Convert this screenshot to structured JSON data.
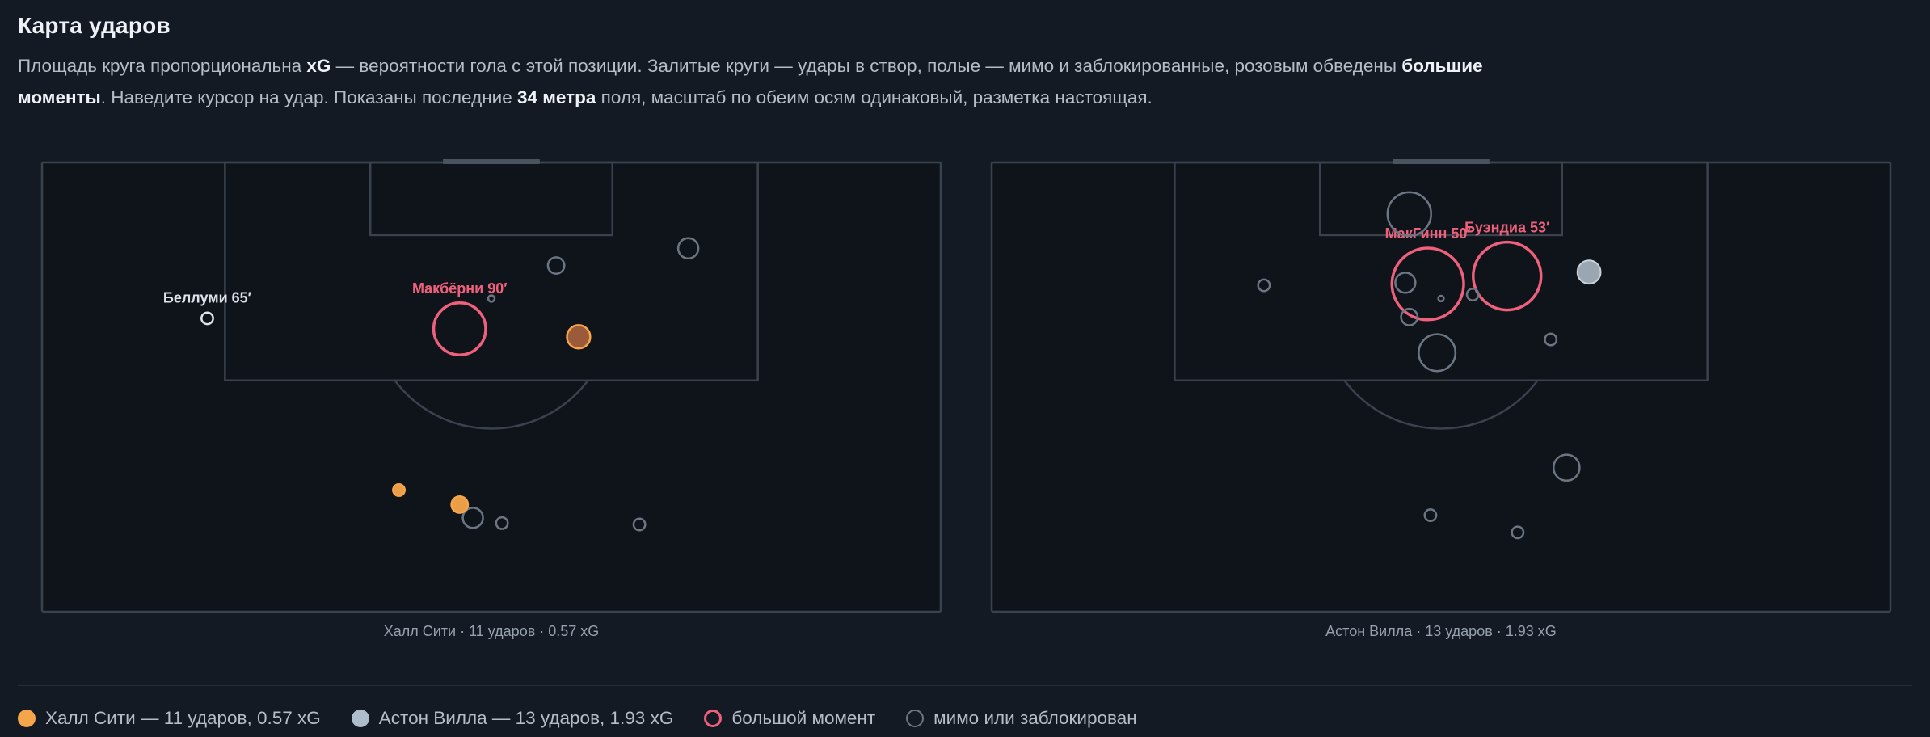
{
  "title": "Карта ударов",
  "description": {
    "p1": "Площадь круга пропорциональна ",
    "b1": "xG",
    "p2": " — вероятности гола с этой позиции. Залитые круги — удары в створ, полые — мимо и заблокированные, розовым обведены ",
    "b2": "большие моменты",
    "p3": ". Наведите курсор на удар. Показаны последние ",
    "b3": "34 метра",
    "p4": " поля, масштаб по обеим осям одинаковый, разметка настоящая."
  },
  "colors": {
    "hull": "#f5a54a",
    "villa": "#aebccb",
    "big_chance": "#ee607b",
    "miss": "#6c7682",
    "lines": "#3a424d",
    "pitch": "#0f141b"
  },
  "legend": {
    "hull": "Халл Сити — 11 ударов, 0.57 xG",
    "villa": "Астон Вилла — 13 ударов, 1.93 xG",
    "big": "большой момент",
    "miss": "мимо или заблокирован"
  },
  "chart_data": [
    {
      "type": "scatter",
      "team": "Халл Сити",
      "caption": "Халл Сити · 11 ударов · 0.57 xG",
      "color_key": "hull",
      "x_unit": "m from centre of goal",
      "y_unit": "m from goal line",
      "shots": [
        {
          "x": -21.5,
          "y": 11.8,
          "xg": 0.01,
          "on_target": false,
          "big_chance": false,
          "label": "Беллуми 65′"
        },
        {
          "x": -2.4,
          "y": 12.6,
          "xg": 0.2,
          "on_target": false,
          "big_chance": true,
          "label": "Макбёрни 90′"
        },
        {
          "x": 6.6,
          "y": 13.2,
          "xg": 0.04,
          "on_target": true,
          "big_chance": false
        },
        {
          "x": 4.9,
          "y": 7.8,
          "xg": 0.02,
          "on_target": false,
          "big_chance": false
        },
        {
          "x": 14.9,
          "y": 6.5,
          "xg": 0.03,
          "on_target": false,
          "big_chance": false
        },
        {
          "x": -7.0,
          "y": 24.8,
          "xg": 0.01,
          "on_target": true,
          "big_chance": false
        },
        {
          "x": -2.4,
          "y": 25.9,
          "xg": 0.02,
          "on_target": true,
          "big_chance": false
        },
        {
          "x": -1.4,
          "y": 26.9,
          "xg": 0.03,
          "on_target": false,
          "big_chance": false
        },
        {
          "x": 0.8,
          "y": 27.3,
          "xg": 0.01,
          "on_target": false,
          "big_chance": false
        },
        {
          "x": 11.2,
          "y": 27.4,
          "xg": 0.01,
          "on_target": false,
          "big_chance": false
        },
        {
          "x": 0.0,
          "y": 10.3,
          "xg": 0.003,
          "on_target": false,
          "big_chance": false
        }
      ]
    },
    {
      "type": "scatter",
      "team": "Астон Вилла",
      "caption": "Астон Вилла · 13 ударов · 1.93 xG",
      "color_key": "villa",
      "x_unit": "m from centre of goal",
      "y_unit": "m from goal line",
      "shots": [
        {
          "x": -2.4,
          "y": 3.9,
          "xg": 0.14,
          "on_target": false,
          "big_chance": false
        },
        {
          "x": -1.0,
          "y": 9.2,
          "xg": 0.38,
          "on_target": false,
          "big_chance": true,
          "label": "МакГинн 50′"
        },
        {
          "x": 5.0,
          "y": 8.6,
          "xg": 0.34,
          "on_target": false,
          "big_chance": true,
          "label": "Буэндиа 53′"
        },
        {
          "x": -2.7,
          "y": 9.1,
          "xg": 0.03,
          "on_target": false,
          "big_chance": false
        },
        {
          "x": 2.4,
          "y": 10.0,
          "xg": 0.01,
          "on_target": false,
          "big_chance": false
        },
        {
          "x": -2.4,
          "y": 11.7,
          "xg": 0.02,
          "on_target": false,
          "big_chance": false
        },
        {
          "x": -0.3,
          "y": 14.4,
          "xg": 0.1,
          "on_target": false,
          "big_chance": false
        },
        {
          "x": 11.2,
          "y": 8.3,
          "xg": 0.04,
          "on_target": true,
          "big_chance": false
        },
        {
          "x": -13.4,
          "y": 9.3,
          "xg": 0.01,
          "on_target": false,
          "big_chance": false
        },
        {
          "x": 8.3,
          "y": 13.4,
          "xg": 0.01,
          "on_target": false,
          "big_chance": false
        },
        {
          "x": 9.5,
          "y": 23.1,
          "xg": 0.05,
          "on_target": false,
          "big_chance": false
        },
        {
          "x": -0.8,
          "y": 26.7,
          "xg": 0.01,
          "on_target": false,
          "big_chance": false
        },
        {
          "x": 5.8,
          "y": 28.0,
          "xg": 0.01,
          "on_target": false,
          "big_chance": false
        },
        {
          "x": 0.0,
          "y": 10.3,
          "xg": 0.002,
          "on_target": false,
          "big_chance": false
        }
      ]
    }
  ]
}
